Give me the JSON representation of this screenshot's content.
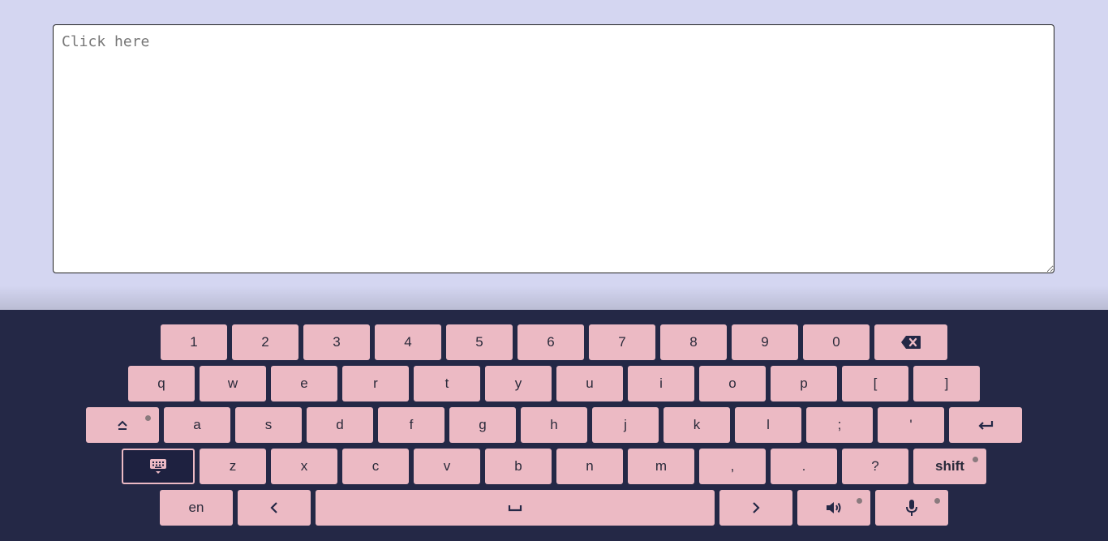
{
  "textarea": {
    "placeholder": "Click here",
    "value": ""
  },
  "keyboard": {
    "row1": [
      "1",
      "2",
      "3",
      "4",
      "5",
      "6",
      "7",
      "8",
      "9",
      "0"
    ],
    "row2": [
      "q",
      "w",
      "e",
      "r",
      "t",
      "y",
      "u",
      "i",
      "o",
      "p",
      "[",
      "]"
    ],
    "row3": [
      "a",
      "s",
      "d",
      "f",
      "g",
      "h",
      "j",
      "k",
      "l",
      ";",
      "'"
    ],
    "row4": [
      "z",
      "x",
      "c",
      "v",
      "b",
      "n",
      "m",
      ",",
      ".",
      "?"
    ],
    "shift_label": "shift",
    "lang_label": "en",
    "icons": {
      "backspace": "backspace-icon",
      "caps": "caps-lock-icon",
      "enter": "enter-icon",
      "hide_keyboard": "hide-keyboard-icon",
      "left": "arrow-left-icon",
      "space": "space-icon",
      "right": "arrow-right-icon",
      "sound": "speaker-icon",
      "mic": "microphone-icon"
    },
    "colors": {
      "key": "#ecbac4",
      "background": "#242846",
      "page": "#d4d6f1"
    }
  }
}
